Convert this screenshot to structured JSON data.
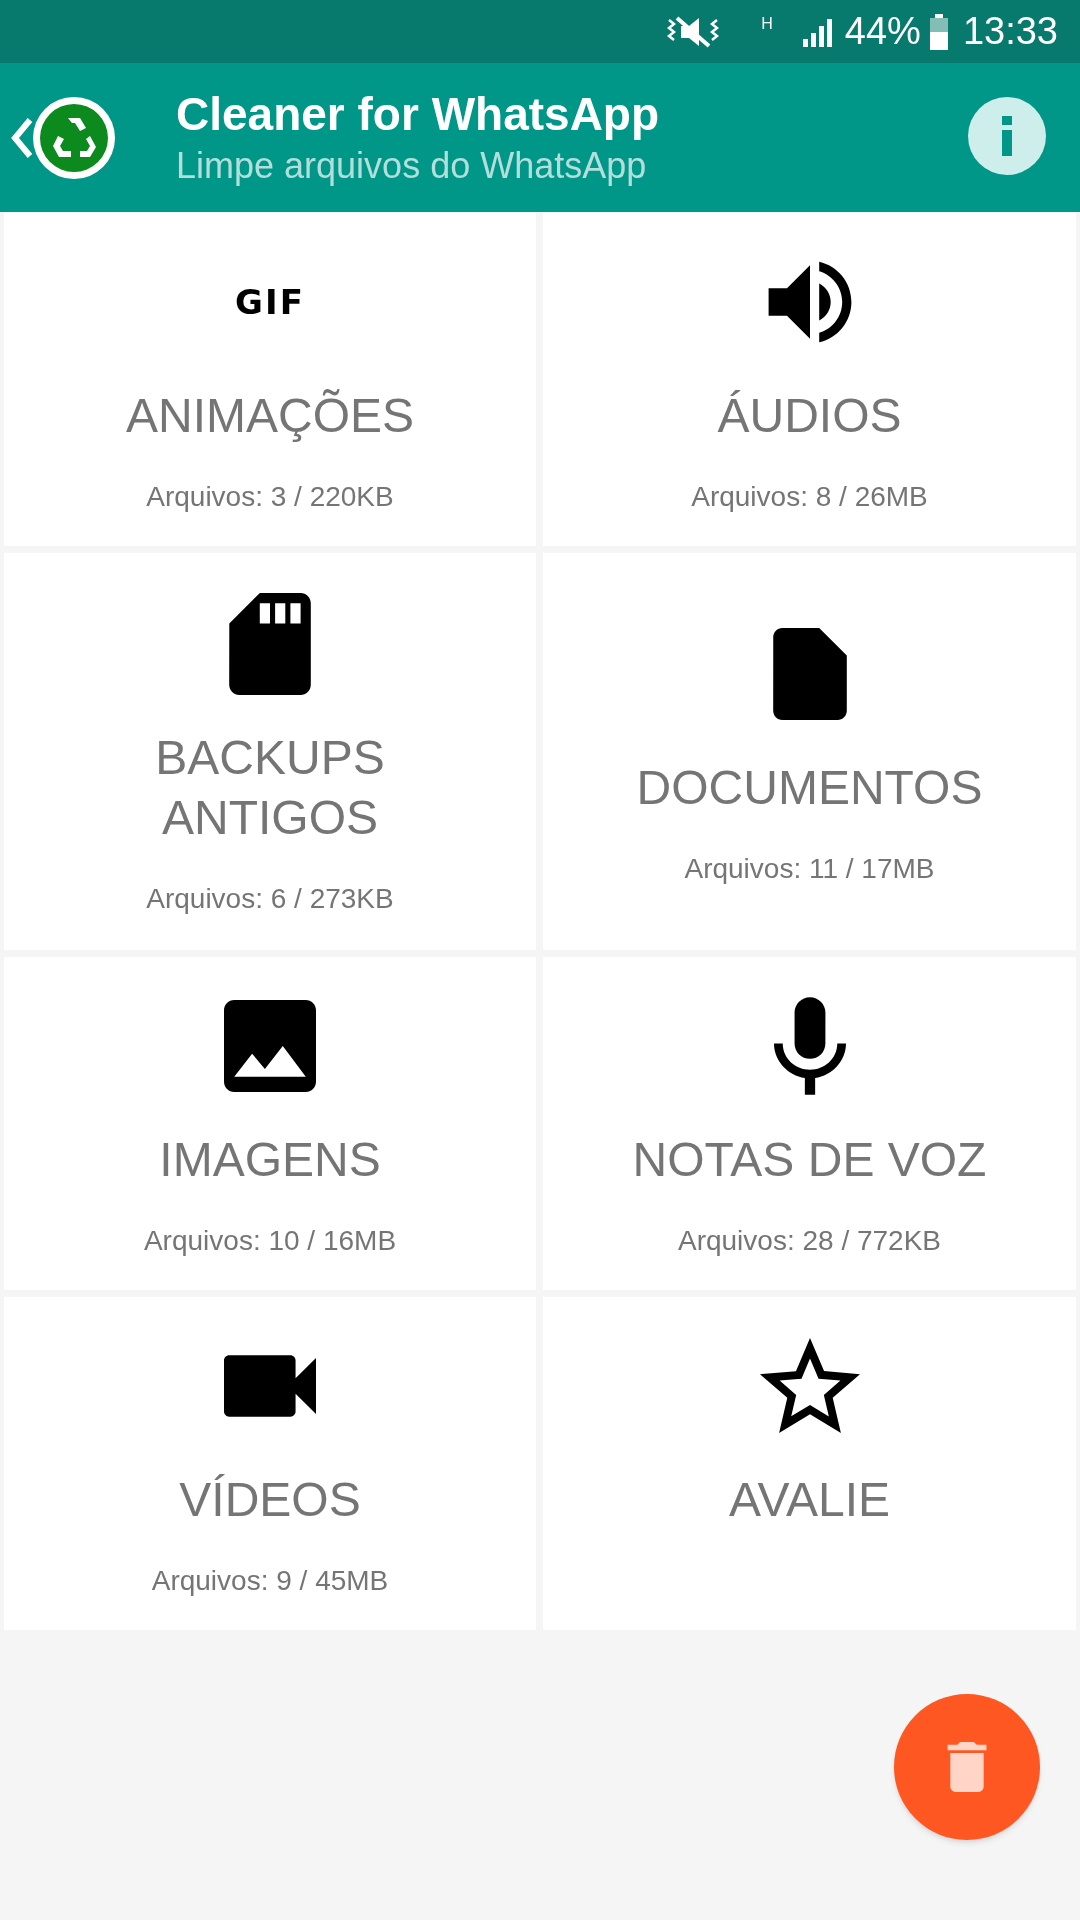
{
  "status_bar": {
    "network": "H",
    "battery": "44%",
    "time": "13:33"
  },
  "app_bar": {
    "title": "Cleaner for WhatsApp",
    "subtitle": "Limpe arquivos do WhatsApp"
  },
  "cards": [
    {
      "icon_text": "GIF",
      "title": "ANIMAÇÕES",
      "info": "Arquivos: 3 / 220KB"
    },
    {
      "title": "ÁUDIOS",
      "info": "Arquivos: 8 / 26MB"
    },
    {
      "title": "BACKUPS\nANTIGOS",
      "info": "Arquivos: 6 / 273KB"
    },
    {
      "title": "DOCUMENTOS",
      "info": "Arquivos: 11 / 17MB"
    },
    {
      "title": "IMAGENS",
      "info": "Arquivos: 10 / 16MB"
    },
    {
      "title": "NOTAS DE VOZ",
      "info": "Arquivos: 28 / 772KB"
    },
    {
      "title": "VÍDEOS",
      "info": "Arquivos: 9 / 45MB"
    },
    {
      "title": "AVALIE"
    }
  ]
}
